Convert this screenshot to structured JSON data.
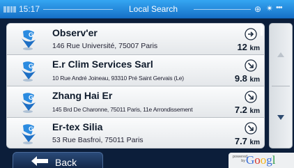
{
  "status_bar": {
    "time": "15:17",
    "title": "Local Search"
  },
  "results": [
    {
      "name": "Observ'er",
      "address": "146 Rue Université, 75007 Paris",
      "distance": "12",
      "unit": "km",
      "direction": "east"
    },
    {
      "name": "E.r Clim Services Sarl",
      "address": "10 Rue André Joineau, 93310 Pré Saint Gervais (Le)",
      "distance": "9.8",
      "unit": "km",
      "direction": "south-east"
    },
    {
      "name": "Zhang Hai Er",
      "address": "145 Brd De Charonne, 75011 Paris, 11e Arrondissement",
      "distance": "7.2",
      "unit": "km",
      "direction": "south-east"
    },
    {
      "name": "Er-tex Silia",
      "address": "53 Rue Basfroi, 75011 Paris",
      "distance": "7.7",
      "unit": "km",
      "direction": "south-east"
    }
  ],
  "footer": {
    "back_label": "Back",
    "powered_label": "powered by",
    "google_logo": "Google"
  },
  "colors": {
    "accent_blue": "#1b7fd6",
    "background": "#0c1e3a",
    "list_background": "#eef0f2"
  },
  "icons": {
    "poi": "google-pin-icon",
    "direction": "direction-arrow-icon",
    "scroll_up": "arrow-up-icon",
    "scroll_down": "arrow-down-icon",
    "back": "back-arrow-icon"
  }
}
